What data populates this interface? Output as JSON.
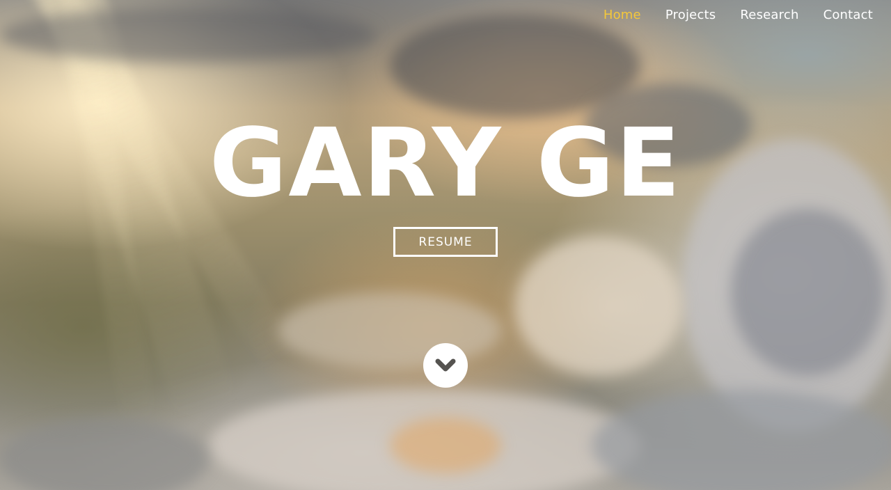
{
  "nav": {
    "items": [
      {
        "label": "Home",
        "active": true
      },
      {
        "label": "Projects",
        "active": false
      },
      {
        "label": "Research",
        "active": false
      },
      {
        "label": "Contact",
        "active": false
      }
    ],
    "active_color": "#f5c83a"
  },
  "hero": {
    "title": "GARY GE",
    "resume_label": "RESUME",
    "scroll_icon": "chevron-down-icon"
  }
}
